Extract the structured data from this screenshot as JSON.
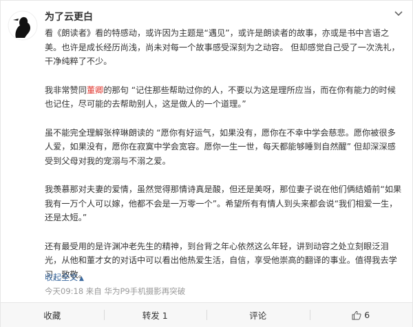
{
  "post": {
    "username": "为了云更白",
    "paragraphs": [
      {
        "segments": [
          {
            "text": "看《朗读者》看的特感动，或许因为主题是“遇见”，或许是朗读者的故事，亦或是书中言语之美。也许是成长经历尚浅，尚未对每一个故事感受深刻为之动容。 但却感觉自己受了一次洗礼，干净纯粹了不少。"
          }
        ]
      },
      {
        "segments": [
          {
            "text": "我非常赞同"
          },
          {
            "text": "董卿",
            "highlight": true
          },
          {
            "text": "的那句 “记住那些帮助过你的人，不要以为这是理所应当，而在你有能力的时候也记住，尽可能的去帮助别人，这是做人的一个道理。”"
          }
        ]
      },
      {
        "segments": [
          {
            "text": "虽不能完全理解张梓琳朗读的 “愿你有好运气，如果没有，愿你在不幸中学会慈悲。愿你被很多人爱，如果没有，愿你在寂寞中学会宽容。愿你一生一世，每天都能够睡到自然醒” 但却深深感受到父母对我的宠溺与不溺之爱。"
          }
        ]
      },
      {
        "segments": [
          {
            "text": "我羡慕那对夫妻的爱情，虽然觉得那情诗真是酸，但还是美呀，那位妻子说在他们俩结婚前“如果我有一万个人可以嫁，他都不会是一万零一个”。希望所有有情人到头来都会说“我们相爱一生，还是太短。”"
          }
        ]
      },
      {
        "segments": [
          {
            "text": "还有最受用的是许渊冲老先生的精神，到台背之年心依然这么年轻，讲到动容之处立刻眼泛泪光，从他和董才女的对话中可以看出他热爱生活，自信，享受他崇高的翻译的事业。值得我去学习，致敬。"
          }
        ]
      }
    ],
    "collapse_label": "收起全文",
    "collapse_arrow": "▲",
    "meta": "今天09:18 来自 华为P9手机摄影再突破"
  },
  "actions": {
    "favorite": "收藏",
    "repost": "转发 1",
    "comment": "评论",
    "like_count": "6"
  },
  "icons": {
    "avatar": "silhouette-avatar",
    "menu": "chevron-down-icon",
    "like": "thumbs-up-icon"
  },
  "colors": {
    "link": "#3b6aa0",
    "highlight": "#e0322a",
    "meta": "#999999"
  }
}
